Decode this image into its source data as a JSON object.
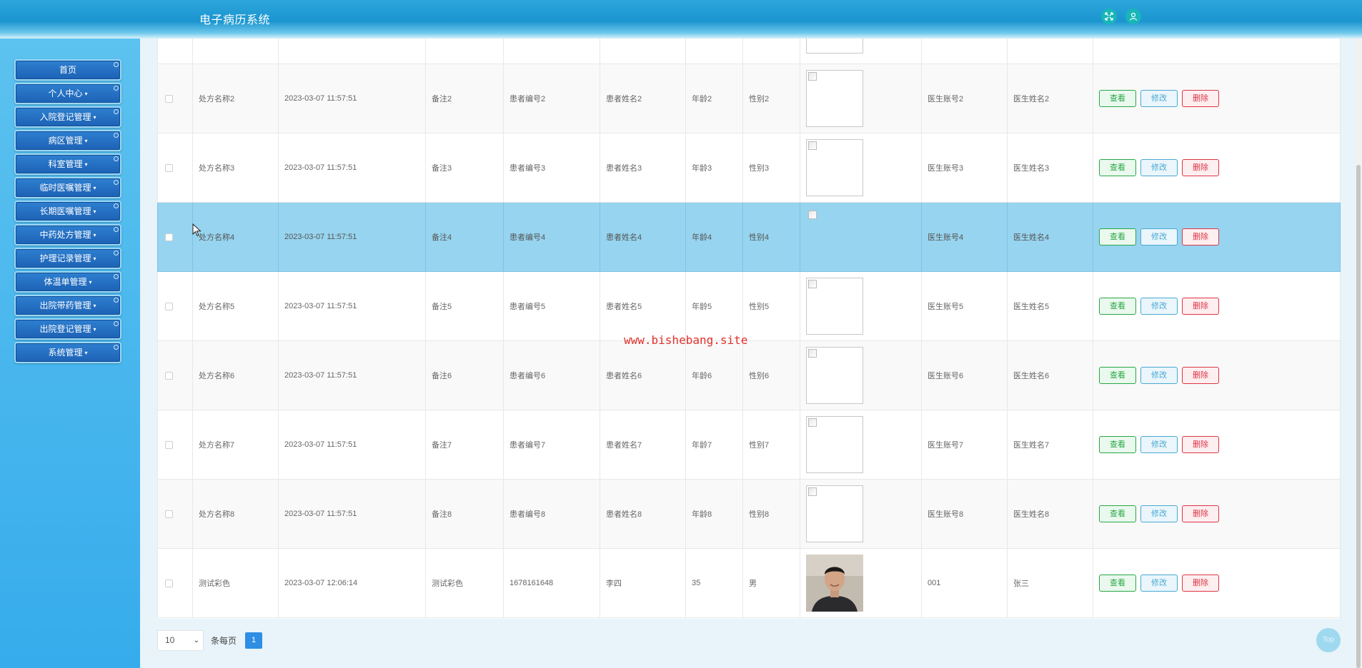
{
  "header": {
    "title": "电子病历系统",
    "icons": [
      "fullscreen-icon",
      "user-icon"
    ],
    "gradient_color": "#1b95cf"
  },
  "sidebar": {
    "items": [
      {
        "label": "首页",
        "has_dropdown": false
      },
      {
        "label": "个人中心",
        "has_dropdown": true
      },
      {
        "label": "入院登记管理",
        "has_dropdown": true
      },
      {
        "label": "病区管理",
        "has_dropdown": true
      },
      {
        "label": "科室管理",
        "has_dropdown": true
      },
      {
        "label": "临时医嘱管理",
        "has_dropdown": true
      },
      {
        "label": "长期医嘱管理",
        "has_dropdown": true
      },
      {
        "label": "中药处方管理",
        "has_dropdown": true
      },
      {
        "label": "护理记录管理",
        "has_dropdown": true
      },
      {
        "label": "体温单管理",
        "has_dropdown": true
      },
      {
        "label": "出院带药管理",
        "has_dropdown": true
      },
      {
        "label": "出院登记管理",
        "has_dropdown": true
      },
      {
        "label": "系统管理",
        "has_dropdown": true
      }
    ]
  },
  "table": {
    "rows": [
      {
        "name": "处方名称2",
        "time": "2023-03-07 11:57:51",
        "remark": "备注2",
        "patient_no": "患者编号2",
        "patient_name": "患者姓名2",
        "age": "年龄2",
        "gender": "性别2",
        "image": "broken",
        "doctor_account": "医生账号2",
        "doctor_name": "医生姓名2",
        "selected": false
      },
      {
        "name": "处方名称3",
        "time": "2023-03-07 11:57:51",
        "remark": "备注3",
        "patient_no": "患者编号3",
        "patient_name": "患者姓名3",
        "age": "年龄3",
        "gender": "性别3",
        "image": "broken",
        "doctor_account": "医生账号3",
        "doctor_name": "医生姓名3",
        "selected": false
      },
      {
        "name": "处方名称4",
        "time": "2023-03-07 11:57:51",
        "remark": "备注4",
        "patient_no": "患者编号4",
        "patient_name": "患者姓名4",
        "age": "年龄4",
        "gender": "性别4",
        "image": "broken",
        "doctor_account": "医生账号4",
        "doctor_name": "医生姓名4",
        "selected": true
      },
      {
        "name": "处方名称5",
        "time": "2023-03-07 11:57:51",
        "remark": "备注5",
        "patient_no": "患者编号5",
        "patient_name": "患者姓名5",
        "age": "年龄5",
        "gender": "性别5",
        "image": "broken",
        "doctor_account": "医生账号5",
        "doctor_name": "医生姓名5",
        "selected": false
      },
      {
        "name": "处方名称6",
        "time": "2023-03-07 11:57:51",
        "remark": "备注6",
        "patient_no": "患者编号6",
        "patient_name": "患者姓名6",
        "age": "年龄6",
        "gender": "性别6",
        "image": "broken",
        "doctor_account": "医生账号6",
        "doctor_name": "医生姓名6",
        "selected": false
      },
      {
        "name": "处方名称7",
        "time": "2023-03-07 11:57:51",
        "remark": "备注7",
        "patient_no": "患者编号7",
        "patient_name": "患者姓名7",
        "age": "年龄7",
        "gender": "性别7",
        "image": "broken",
        "doctor_account": "医生账号7",
        "doctor_name": "医生姓名7",
        "selected": false
      },
      {
        "name": "处方名称8",
        "time": "2023-03-07 11:57:51",
        "remark": "备注8",
        "patient_no": "患者编号8",
        "patient_name": "患者姓名8",
        "age": "年龄8",
        "gender": "性别8",
        "image": "broken",
        "doctor_account": "医生账号8",
        "doctor_name": "医生姓名8",
        "selected": false
      },
      {
        "name": "测试彩色",
        "time": "2023-03-07 12:06:14",
        "remark": "测试彩色",
        "patient_no": "1678161648",
        "patient_name": "李四",
        "age": "35",
        "gender": "男",
        "image": "photo",
        "doctor_account": "001",
        "doctor_name": "张三",
        "selected": false
      }
    ],
    "actions": {
      "view": "查看",
      "edit": "修改",
      "delete": "删除"
    }
  },
  "watermark": "www.bishebang.site",
  "pagination": {
    "page_size": "10",
    "per_page_label": "条每页",
    "current_page": "1"
  },
  "to_top": "Top"
}
